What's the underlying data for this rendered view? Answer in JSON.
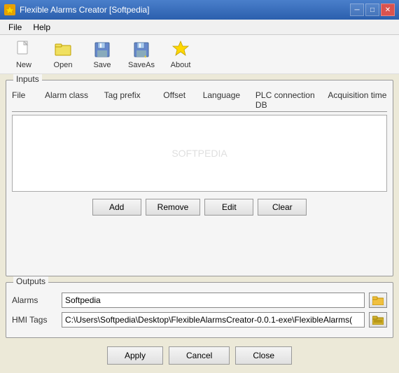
{
  "window": {
    "title": "Flexible Alarms Creator [Softpedia]",
    "watermark": "SOFTPEDIA"
  },
  "menubar": {
    "items": [
      {
        "id": "file-menu",
        "label": "File"
      },
      {
        "id": "help-menu",
        "label": "Help"
      }
    ]
  },
  "toolbar": {
    "buttons": [
      {
        "id": "new-btn",
        "label": "New",
        "icon": "new-icon"
      },
      {
        "id": "open-btn",
        "label": "Open",
        "icon": "open-icon"
      },
      {
        "id": "save-btn",
        "label": "Save",
        "icon": "save-icon"
      },
      {
        "id": "saveas-btn",
        "label": "SaveAs",
        "icon": "saveas-icon"
      },
      {
        "id": "about-btn",
        "label": "About",
        "icon": "about-icon"
      }
    ]
  },
  "inputs": {
    "group_label": "Inputs",
    "columns": [
      "File",
      "Alarm class",
      "Tag prefix",
      "Offset",
      "Language",
      "PLC connection DB",
      "Acquisition time"
    ],
    "buttons": {
      "add": "Add",
      "remove": "Remove",
      "edit": "Edit",
      "clear": "Clear"
    }
  },
  "outputs": {
    "group_label": "Outputs",
    "alarms_label": "Alarms",
    "alarms_value": "Softpedia",
    "hmitags_label": "HMI Tags",
    "hmitags_value": "C:\\Users\\Softpedia\\Desktop\\FlexibleAlarmsCreator-0.0.1-exe\\FlexibleAlarms("
  },
  "bottom_buttons": {
    "apply": "Apply",
    "cancel": "Cancel",
    "close": "Close"
  },
  "titlebar": {
    "minimize": "─",
    "maximize": "□",
    "close": "✕"
  }
}
